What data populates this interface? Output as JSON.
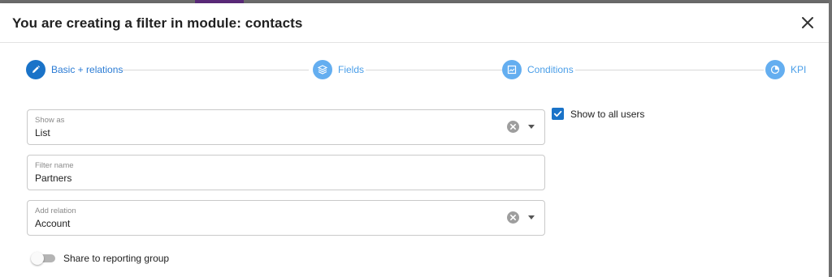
{
  "dialog": {
    "title": "You are creating a filter in module: contacts",
    "close_icon": "close-icon"
  },
  "stepper": {
    "steps": [
      {
        "label": "Basic + relations",
        "icon": "pencil-icon",
        "state": "active"
      },
      {
        "label": "Fields",
        "icon": "layers-icon",
        "state": "inactive"
      },
      {
        "label": "Conditions",
        "icon": "image-icon",
        "state": "inactive"
      },
      {
        "label": "KPI",
        "icon": "pie-chart-icon",
        "state": "inactive"
      }
    ]
  },
  "form": {
    "show_as": {
      "label": "Show as",
      "value": "List"
    },
    "filter_name": {
      "label": "Filter name",
      "value": "Partners"
    },
    "add_relation": {
      "label": "Add relation",
      "value": "Account"
    },
    "show_to_all_users": {
      "label": "Show to all users",
      "checked": true
    },
    "share_to_reporting_group": {
      "label": "Share to reporting group",
      "enabled": false
    }
  },
  "colors": {
    "accent": "#1a73c8",
    "accent_light": "#64aef0",
    "text": "#212121",
    "muted": "#8a8a8a"
  }
}
